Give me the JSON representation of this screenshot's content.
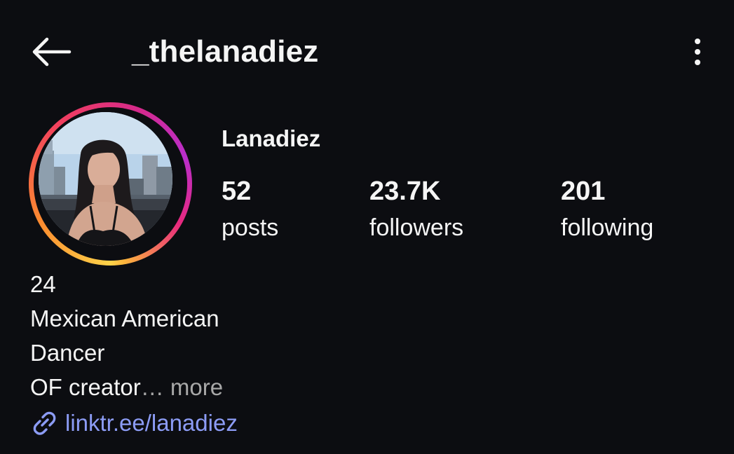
{
  "header": {
    "username": "_thelanadiez",
    "back_icon": "arrow-left-icon",
    "more_icon": "more-vertical-icon"
  },
  "profile": {
    "display_name": "Lanadiez",
    "stats": {
      "posts": {
        "value": "52",
        "label": "posts"
      },
      "followers": {
        "value": "23.7K",
        "label": "followers"
      },
      "following": {
        "value": "201",
        "label": "following"
      }
    },
    "has_story_ring": true
  },
  "bio": {
    "line1": "24",
    "line2": "Mexican American",
    "line3": "Dancer",
    "line4": "OF creator",
    "ellipsis": "…",
    "more_label": "more",
    "link": {
      "text": "linktr.ee/lanadiez",
      "icon": "link-icon"
    }
  },
  "colors": {
    "background": "#0c0d11",
    "text": "#f5f5f5",
    "muted": "#a8a8a8",
    "link": "#8c9cf5"
  }
}
